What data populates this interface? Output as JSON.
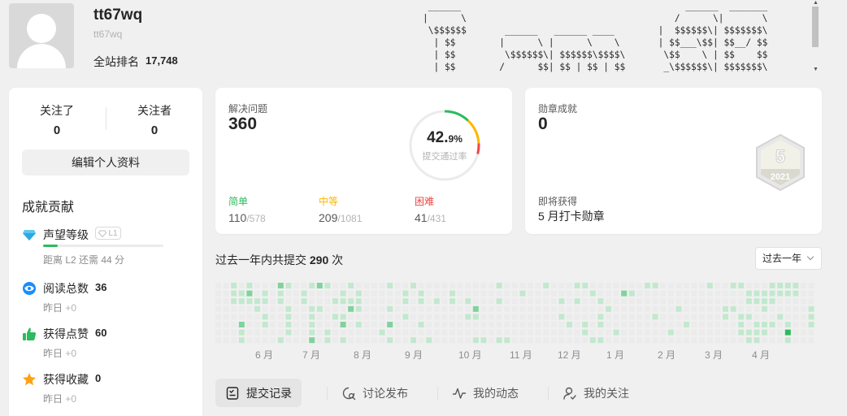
{
  "profile": {
    "username": "tt67wq",
    "user_id": "tt67wq",
    "rank_label": "全站排名",
    "rank_value": "17,748",
    "ascii_art": " ______                                         ______  _______\n|      \\                                      /      \\|       \\\n \\$$$$$$       ______   ______ ____        |  $$$$$$\\| $$$$$$$\\\n  | $$        |      \\ |      \\    \\       | $$___\\$$| $$__/ $$\n  | $$         \\$$$$$$\\| $$$$$$\\$$$$\\       \\$$    \\ | $$    $$\n  | $$        /      $$| $$ | $$ | $$       _\\$$$$$$\\| $$$$$$$\\"
  },
  "sidebar": {
    "following_label": "关注了",
    "following_count": "0",
    "followers_label": "关注者",
    "followers_count": "0",
    "edit_button": "编辑个人资料",
    "contrib_title": "成就贡献",
    "reputation": {
      "label": "声望等级",
      "badge": "L1",
      "sub": "距离 L2 还需 44 分",
      "progress": 0.12
    },
    "reads": {
      "label": "阅读总数",
      "value": "36",
      "sub_prefix": "昨日",
      "sub_delta": "+0"
    },
    "likes": {
      "label": "获得点赞",
      "value": "60",
      "sub_prefix": "昨日",
      "sub_delta": "+0"
    },
    "favs": {
      "label": "获得收藏",
      "value": "0",
      "sub_prefix": "昨日",
      "sub_delta": "+0"
    }
  },
  "solved": {
    "title": "解决问题",
    "count": "360",
    "rate_int": "42.",
    "rate_dec": "9%",
    "rate_label": "提交通过率",
    "easy_label": "简单",
    "easy_solved": "110",
    "easy_total": "/578",
    "medium_label": "中等",
    "medium_solved": "209",
    "medium_total": "/1081",
    "hard_label": "困难",
    "hard_solved": "41",
    "hard_total": "/431",
    "ring_fractions": {
      "easy": 0.12,
      "medium": 0.12,
      "hard": 0.05
    }
  },
  "badges": {
    "title": "勋章成就",
    "count": "0",
    "next_label": "即将获得",
    "next_badge": "5 月打卡勋章",
    "hex_number": "5",
    "hex_year": "2021"
  },
  "calendar": {
    "title_prefix": "过去一年内共提交",
    "total": "290",
    "title_suffix": "次",
    "range_select": "过去一年",
    "months": [
      "6 月",
      "7 月",
      "8 月",
      "9 月",
      "10 月",
      "11 月",
      "12 月",
      "1 月",
      "2 月",
      "3 月",
      "4 月"
    ],
    "levels": [
      0,
      0,
      0,
      0,
      0,
      0,
      0,
      0,
      0,
      0,
      0,
      0,
      0,
      0,
      0,
      0,
      1,
      1,
      1,
      0,
      0,
      0,
      0,
      0,
      0,
      1,
      1,
      0,
      0,
      2,
      1,
      1,
      1,
      2,
      1,
      0,
      0,
      0,
      0,
      0,
      0,
      0,
      1,
      1,
      0,
      0,
      0,
      0,
      0,
      1,
      1,
      0,
      1,
      1,
      0,
      0,
      0,
      0,
      0,
      0,
      0,
      0,
      0,
      0,
      2,
      1,
      1,
      0,
      0,
      0,
      0,
      1,
      1,
      0,
      0,
      1,
      1,
      1,
      1,
      0,
      0,
      0,
      0,
      0,
      0,
      0,
      0,
      0,
      0,
      1,
      1,
      0,
      0,
      0,
      0,
      0,
      1,
      0,
      0,
      1,
      1,
      1,
      1,
      2,
      2,
      0,
      0,
      1,
      0,
      0,
      0,
      0,
      1,
      0,
      0,
      0,
      0,
      0,
      1,
      1,
      0,
      0,
      1,
      0,
      1,
      0,
      0,
      0,
      0,
      1,
      1,
      0,
      1,
      2,
      0,
      1,
      1,
      0,
      1,
      2,
      0,
      0,
      0,
      0,
      0,
      1,
      1,
      1,
      0,
      1,
      0,
      0,
      0,
      0,
      0,
      0,
      0,
      0,
      0,
      0,
      0,
      0,
      0,
      0,
      0,
      0,
      0,
      0,
      0,
      0,
      0,
      0,
      0,
      0,
      1,
      0,
      1,
      0,
      0,
      1,
      0,
      2,
      0,
      1,
      0,
      0,
      0,
      0,
      0,
      0,
      0,
      0,
      0,
      1,
      1,
      0,
      1,
      0,
      0,
      0,
      1,
      0,
      0,
      0,
      0,
      0,
      0,
      1,
      0,
      1,
      1,
      0,
      0,
      1,
      0,
      0,
      0,
      0,
      0,
      0,
      0,
      0,
      0,
      1,
      0,
      0,
      1,
      0,
      0,
      0,
      0,
      0,
      0,
      0,
      0,
      0,
      0,
      0,
      0,
      0,
      0,
      1,
      1,
      0,
      0,
      0,
      0,
      0,
      0,
      0,
      0,
      0,
      0,
      0,
      0,
      0,
      0,
      0,
      1,
      0,
      1,
      0,
      0,
      0,
      0,
      0,
      0,
      2,
      1,
      0,
      0,
      1,
      0,
      0,
      0,
      0,
      0,
      0,
      0,
      1,
      0,
      0,
      0,
      0,
      0,
      0,
      0,
      0,
      1,
      0,
      1,
      0,
      0,
      0,
      0,
      1,
      0,
      0,
      0,
      0,
      0,
      0,
      0,
      1,
      0,
      0,
      0,
      0,
      0,
      0,
      0,
      0,
      0,
      1,
      0,
      0,
      0,
      0,
      0,
      0,
      0,
      0,
      0,
      0,
      0,
      0,
      0,
      0,
      0,
      0,
      0,
      0,
      0,
      0,
      0,
      0,
      1,
      0,
      0,
      0,
      0,
      0,
      0,
      0,
      0,
      0,
      0,
      0,
      0,
      0,
      0,
      0,
      0,
      0,
      1,
      0,
      1,
      0,
      0,
      0,
      0,
      0,
      0,
      0,
      0,
      1,
      0,
      0,
      1,
      0,
      1,
      0,
      0,
      0,
      0,
      0,
      1,
      0,
      0,
      0,
      0,
      1,
      1,
      0,
      0,
      1,
      0,
      0,
      0,
      0,
      0,
      1,
      0,
      0,
      1,
      0,
      1,
      1,
      0,
      1,
      0,
      0,
      0,
      1,
      0,
      0,
      0,
      0,
      0,
      0,
      0,
      0,
      0,
      0,
      1,
      0,
      0,
      2,
      0,
      0,
      0,
      0,
      0,
      0,
      0,
      1,
      0,
      0,
      0,
      0,
      0,
      0,
      0,
      0,
      0,
      0,
      0,
      0,
      0,
      0,
      1,
      0,
      0,
      0,
      0,
      0,
      0,
      0,
      1,
      0,
      0,
      0,
      1,
      0,
      0,
      0,
      0,
      0,
      0,
      0,
      0,
      0,
      0,
      0,
      0,
      0,
      0,
      0,
      0,
      0,
      1,
      0,
      0,
      0,
      0,
      1,
      0,
      0,
      0,
      0,
      0,
      0,
      0,
      0,
      0,
      1,
      0,
      0,
      0,
      0,
      0,
      0,
      0,
      0,
      0,
      0,
      0,
      0,
      0,
      0,
      0,
      0,
      0,
      0,
      1,
      0,
      0,
      0,
      0,
      0,
      0,
      0,
      0,
      0,
      0,
      0,
      0,
      0,
      0,
      0,
      0,
      0,
      0,
      1,
      1,
      0,
      0,
      0,
      1,
      0,
      0,
      1,
      0,
      0,
      0,
      0,
      1,
      0,
      0,
      0,
      1,
      1,
      1,
      0,
      0,
      1,
      1,
      0,
      1,
      0,
      1,
      1,
      0,
      1,
      1,
      0,
      0,
      1,
      1,
      1,
      0,
      1,
      1,
      1,
      0,
      1,
      1,
      0,
      1,
      1,
      1,
      0,
      0,
      1,
      0,
      0,
      1,
      1,
      0,
      0,
      1,
      0,
      0,
      0,
      1,
      1,
      0,
      0,
      0,
      1,
      3,
      1,
      1,
      1,
      0
    ]
  },
  "tabs": [
    {
      "label": "提交记录"
    },
    {
      "label": "讨论发布"
    },
    {
      "label": "我的动态"
    },
    {
      "label": "我的关注"
    }
  ],
  "colors": {
    "easy": "#2cbb5d",
    "medium": "#ffb700",
    "hard": "#ef4743",
    "heat": [
      "#ebebeb",
      "#c2e8ce",
      "#7fd39b",
      "#2cbb5d",
      "#1e8a43"
    ]
  }
}
